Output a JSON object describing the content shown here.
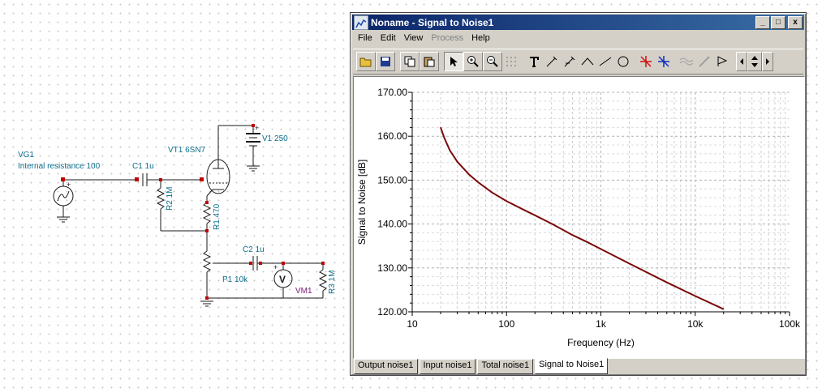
{
  "schematic": {
    "source_name": "VG1",
    "source_note": "Internal resistance 100",
    "tube": "VT1 6SN7",
    "supply": "V1 250",
    "c1": "C1 1u",
    "r2": "R2 1M",
    "r1": "R1 470",
    "c2": "C2 1u",
    "pot": "P1 10k",
    "meter": "VM1",
    "meter_glyph": "V",
    "r3": "R3 1M",
    "plus": "+"
  },
  "window": {
    "title": "Noname - Signal to Noise1",
    "controls": {
      "minimize": "_",
      "maximize": "□",
      "close": "x"
    },
    "menu": [
      "File",
      "Edit",
      "View",
      "Process",
      "Help"
    ],
    "disabled_menu": [
      "Process"
    ],
    "toolbar_icons": [
      "open-icon",
      "save-icon",
      "copy-icon",
      "paste-icon",
      "pointer-icon",
      "zoom-in-icon",
      "zoom-reset-icon",
      "grid-icon",
      "text-icon",
      "marker-icon",
      "marker-b-icon",
      "line-tool-icon",
      "line-icon",
      "circle-icon",
      "cursor-a-icon",
      "cursor-b-icon",
      "curve-icon",
      "pen-icon",
      "flag-icon",
      "nav-left-icon",
      "nav-updown-icon",
      "nav-right-icon"
    ],
    "tabs": [
      "Output noise1",
      "Input noise1",
      "Total noise1",
      "Signal to Noise1"
    ],
    "active_tab": "Signal to Noise1"
  },
  "chart_data": {
    "type": "line",
    "xlabel": "Frequency (Hz)",
    "ylabel": "Signal to Noise [dB]",
    "xscale": "log",
    "xlim": [
      10,
      100000
    ],
    "ylim": [
      120,
      170
    ],
    "x_ticks": [
      10,
      100,
      1000,
      10000,
      100000
    ],
    "x_tick_labels": [
      "10",
      "100",
      "1k",
      "10k",
      "100k"
    ],
    "y_ticks": [
      120,
      130,
      140,
      150,
      160,
      170
    ],
    "y_tick_labels": [
      "120.00",
      "130.00",
      "140.00",
      "150.00",
      "160.00",
      "170.00"
    ],
    "grid": true,
    "series": [
      {
        "color": "#7a0a0a",
        "x": [
          20,
          22,
          25,
          30,
          40,
          50,
          70,
          100,
          150,
          200,
          300,
          500,
          700,
          1000,
          2000,
          5000,
          10000,
          20000
        ],
        "y": [
          162,
          159.5,
          156.8,
          154.2,
          151.3,
          149.5,
          147.2,
          145.2,
          143.3,
          142.0,
          140.1,
          137.5,
          136.0,
          134.3,
          131.0,
          126.7,
          123.6,
          120.6
        ]
      }
    ]
  }
}
